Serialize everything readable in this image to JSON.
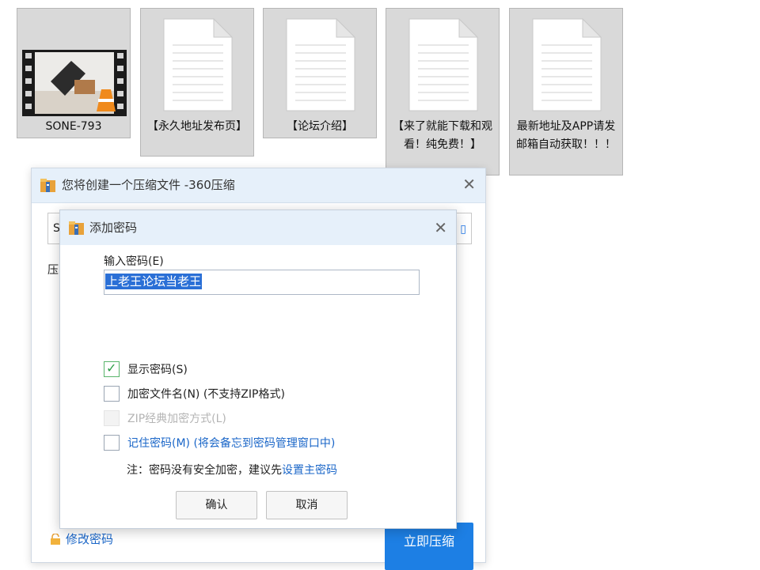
{
  "desktop": {
    "files": [
      {
        "label": "SONE-793",
        "type": "video"
      },
      {
        "label": "【永久地址发布页】",
        "type": "document"
      },
      {
        "label": "【论坛介绍】",
        "type": "document"
      },
      {
        "label": "【来了就能下载和观看！纯免费！】",
        "type": "document"
      },
      {
        "label": "最新地址及APP请发邮箱自动获取！！！",
        "type": "document"
      }
    ]
  },
  "outer_dialog": {
    "title": "您将创建一个压缩文件 -360压缩",
    "name_prefix": "S",
    "name_suffix_icon": "folder-icon",
    "compress_label_prefix": "压",
    "modify_password": "修改密码",
    "compress_now": "立即压缩"
  },
  "inner_dialog": {
    "title": "添加密码",
    "password_label": "输入密码(E)",
    "password_value": "上老王论坛当老王",
    "options": [
      {
        "label": "显示密码(S)",
        "checked": true,
        "enabled": true
      },
      {
        "label": "加密文件名(N) (不支持ZIP格式)",
        "checked": false,
        "enabled": true
      },
      {
        "label": "ZIP经典加密方式(L)",
        "checked": false,
        "enabled": false
      },
      {
        "label": "记住密码(M) (将会备忘到密码管理窗口中)",
        "checked": false,
        "enabled": true
      }
    ],
    "note_prefix": "注：密码没有安全加密，建议先",
    "note_link": "设置主密码",
    "ok_label": "确认",
    "cancel_label": "取消"
  },
  "colors": {
    "title_bar": "#e6f0fa",
    "accent": "#1d7fe4",
    "link": "#1a66c8",
    "check": "#2e9e48",
    "selection": "#2a6fd6"
  }
}
